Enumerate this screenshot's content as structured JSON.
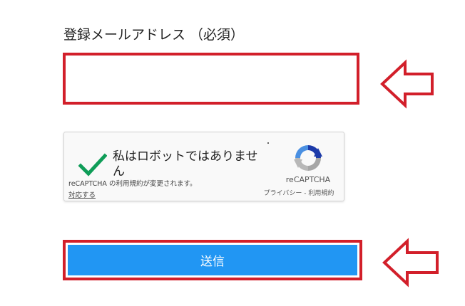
{
  "form": {
    "email_label": "登録メールアドレス （必須）",
    "email_value": "",
    "submit_label": "送信"
  },
  "recaptcha": {
    "checkbox_label": "私はロボットではありません",
    "brand": "reCAPTCHA",
    "privacy_link": "プライバシー",
    "links_separator": " - ",
    "terms_link": "利用規約",
    "notice": "reCAPTCHA の利用規約が変更されます。",
    "respond_link": "対応する"
  },
  "colors": {
    "highlight_red": "#d21f2a",
    "submit_blue": "#2196f3",
    "checkmark_green": "#0f9d58"
  },
  "icons": {
    "checkmark": "checkmark-icon",
    "recaptcha_logo": "recaptcha-logo-icon",
    "arrow": "left-arrow-outline-icon"
  }
}
